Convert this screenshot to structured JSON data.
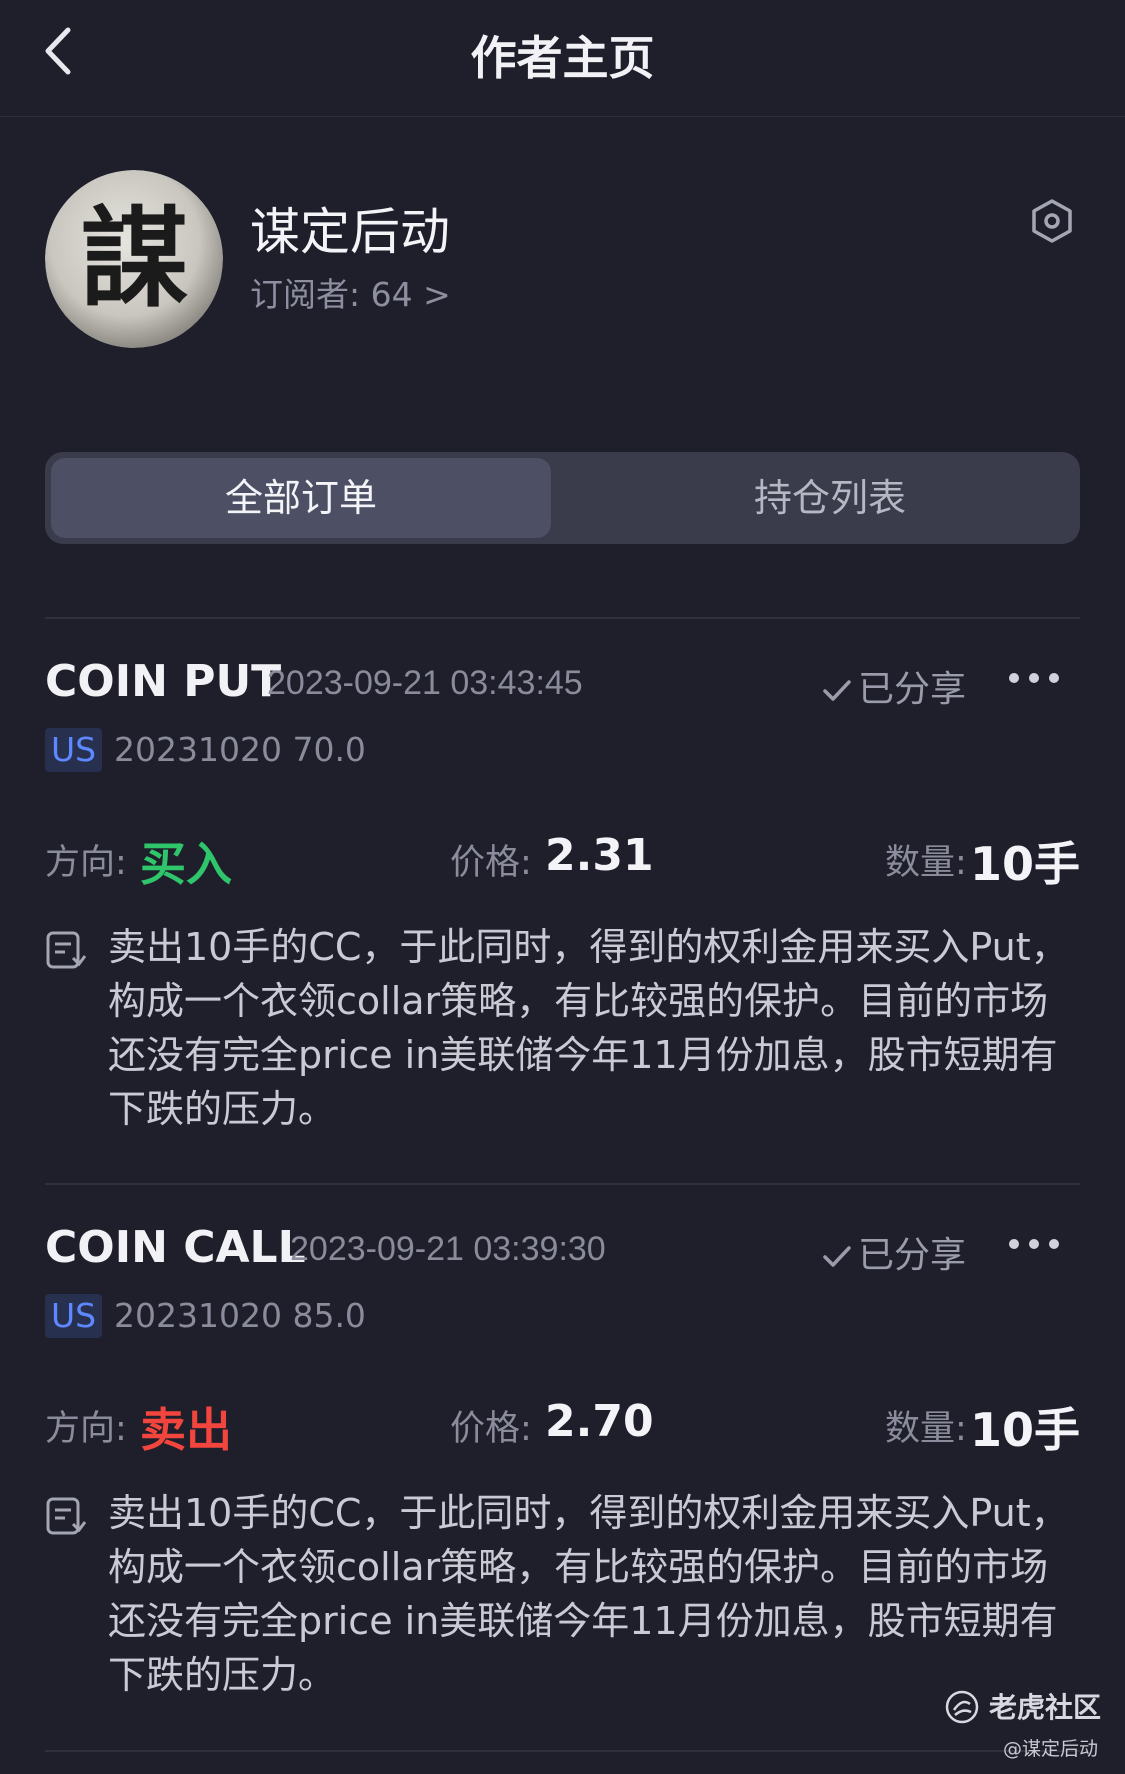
{
  "header": {
    "title": "作者主页",
    "back_icon": "chevron-left-icon"
  },
  "profile": {
    "avatar_char": "謀",
    "name": "谋定后动",
    "subscribers": "订阅者: 64 >",
    "settings_icon": "hexagon-settings-icon"
  },
  "tabs": [
    {
      "label": "全部订单",
      "active": true
    },
    {
      "label": "持仓列表",
      "active": false
    }
  ],
  "orders": [
    {
      "symbol": "COIN PUT",
      "time": "2023-09-21 03:43:45",
      "shared": "已分享",
      "market": "US",
      "contract": "20231020 70.0",
      "direction_label": "方向:",
      "direction": "买入",
      "direction_color": "#2fc56b",
      "price_label": "价格:",
      "price": "2.31",
      "qty_label": "数量:",
      "qty": "10手",
      "note": "卖出10手的CC，于此同时，得到的权利金用来买入Put，构成一个衣领collar策略，有比较强的保护。目前的市场还没有完全price in美联储今年11月份加息，股市短期有下跌的压力。"
    },
    {
      "symbol": "COIN CALL",
      "time": "2023-09-21 03:39:30",
      "shared": "已分享",
      "market": "US",
      "contract": "20231020 85.0",
      "direction_label": "方向:",
      "direction": "卖出",
      "direction_color": "#f2453d",
      "price_label": "价格:",
      "price": "2.70",
      "qty_label": "数量:",
      "qty": "10手",
      "note": "卖出10手的CC，于此同时，得到的权利金用来买入Put，构成一个衣领collar策略，有比较强的保护。目前的市场还没有完全price in美联储今年11月份加息，股市短期有下跌的压力。"
    }
  ],
  "watermark": {
    "name": "老虎社区",
    "handle": "@谋定后动"
  }
}
